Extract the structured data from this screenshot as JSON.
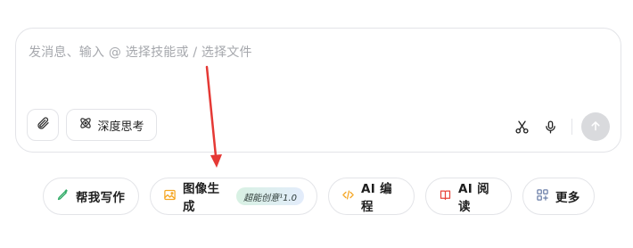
{
  "composer": {
    "placeholder": "发消息、输入 @ 选择技能或 / 选择文件",
    "deep_think_label": "深度思考"
  },
  "icons": {
    "attach": "paperclip-icon",
    "deep_think": "atom-icon",
    "scissors": "scissors-icon",
    "mic": "microphone-icon",
    "send": "arrow-up-icon"
  },
  "chips": [
    {
      "label": "帮我写作",
      "icon": "pen-sparkle-icon",
      "icon_color": "#2aa862"
    },
    {
      "label": "图像生成",
      "icon": "image-icon",
      "icon_color": "#f5a623",
      "badge": "超能创意¹1.0"
    },
    {
      "label": "AI 编程",
      "icon": "code-icon",
      "icon_color": "#f5a623"
    },
    {
      "label": "AI 阅读",
      "icon": "book-icon",
      "icon_color": "#e8453c"
    },
    {
      "label": "更多",
      "icon": "grid-plus-icon",
      "icon_color": "#6b7fa8"
    }
  ],
  "annotation": {
    "arrow_color": "#e53935"
  }
}
